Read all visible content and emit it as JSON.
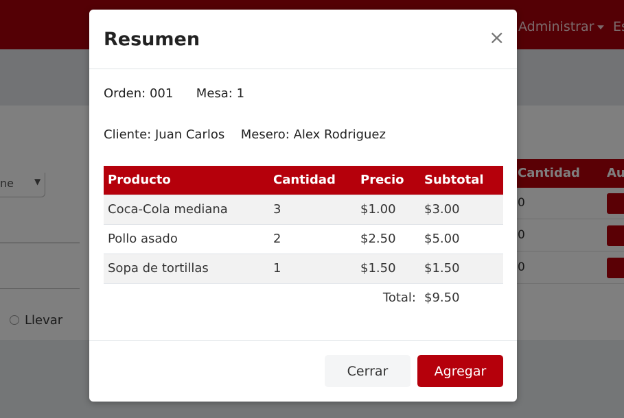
{
  "navbar": {
    "admin_label": "Administrar",
    "es_label": "Es"
  },
  "background": {
    "select_text": "ne",
    "radio_label": "Llevar",
    "table_headers": [
      "Cantidad",
      "Au"
    ],
    "rows": [
      "0",
      "0",
      "0"
    ]
  },
  "modal": {
    "title": "Resumen",
    "close_symbol": "×",
    "orden_label": "Orden:",
    "orden_value": "001",
    "mesa_label": "Mesa:",
    "mesa_value": "1",
    "cliente_label": "Cliente:",
    "cliente_value": "Juan Carlos",
    "mesero_label": "Mesero:",
    "mesero_value": "Alex Rodriguez",
    "table": {
      "headers": [
        "Producto",
        "Cantidad",
        "Precio",
        "Subtotal"
      ],
      "rows": [
        [
          "Coca-Cola mediana",
          "3",
          "$1.00",
          "$3.00"
        ],
        [
          "Pollo asado",
          "2",
          "$2.50",
          "$5.00"
        ],
        [
          "Sopa de tortillas",
          "1",
          "$1.50",
          "$1.50"
        ]
      ],
      "total_label": "Total:",
      "total_value": "$9.50"
    },
    "buttons": {
      "cerrar": "Cerrar",
      "agregar": "Agregar"
    }
  },
  "colors": {
    "brand": "#b5000b",
    "navbar": "#a8000a"
  }
}
